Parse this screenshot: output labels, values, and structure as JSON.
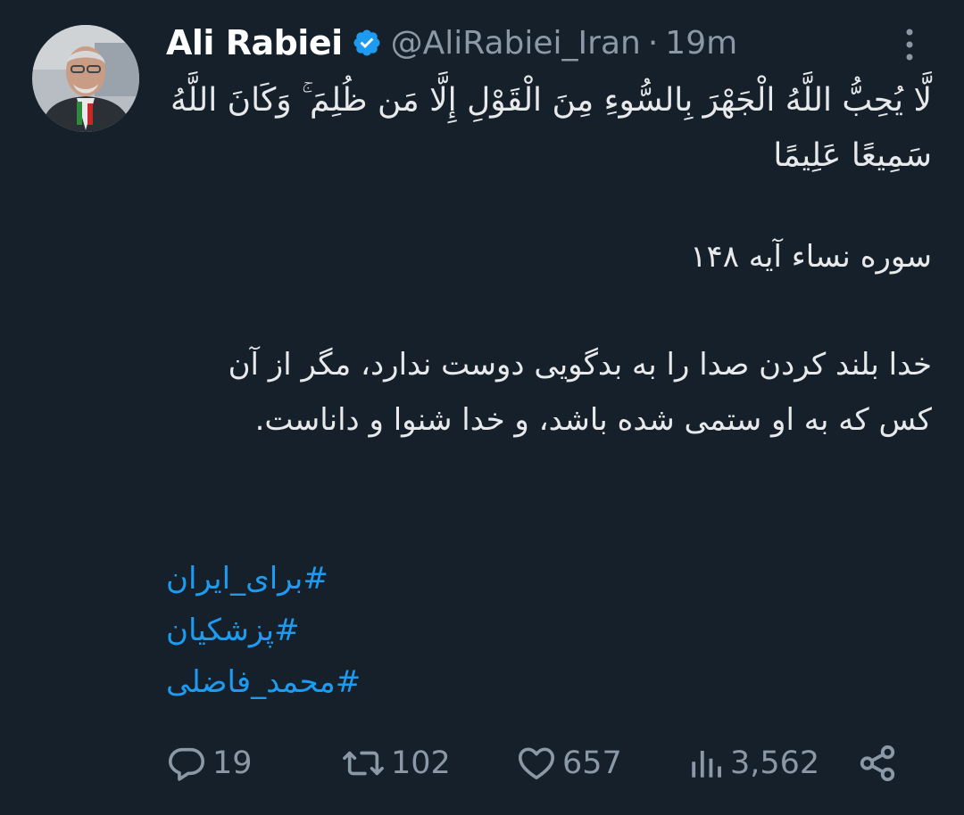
{
  "author": {
    "name": "Ali Rabiei",
    "handle": "@AliRabiei_Iran",
    "separator": "·",
    "time": "19m"
  },
  "tweet": {
    "quran_verse": "لَّا يُحِبُّ اللَّهُ الْجَهْرَ بِالسُّوءِ مِنَ الْقَوْلِ إِلَّا مَن ظُلِمَ ۚ وَكَانَ اللَّهُ سَمِيعًا عَلِيمًا",
    "reference": "سوره نساء آیه ۱۴۸",
    "translation": "خدا بلند کردن صدا را به بدگویی دوست ندارد، مگر از آن کس که به او ستمی شده باشد، و خدا شنوا و داناست.",
    "hashtags": [
      "#برای_ایران",
      "#پزشکیان",
      "#محمد_فاضلی"
    ]
  },
  "actions": {
    "replies": "19",
    "retweets": "102",
    "likes": "657",
    "views": "3,562"
  },
  "colors": {
    "background": "#15202b",
    "primary_text": "#e7e9ea",
    "secondary_text": "#8b98a5",
    "accent": "#1d9bf0"
  },
  "icons": {
    "verified": "verified-badge-icon",
    "more": "more-vertical-icon",
    "reply": "reply-icon",
    "retweet": "retweet-icon",
    "like": "heart-icon",
    "views": "views-bar-chart-icon",
    "share": "share-icon"
  }
}
